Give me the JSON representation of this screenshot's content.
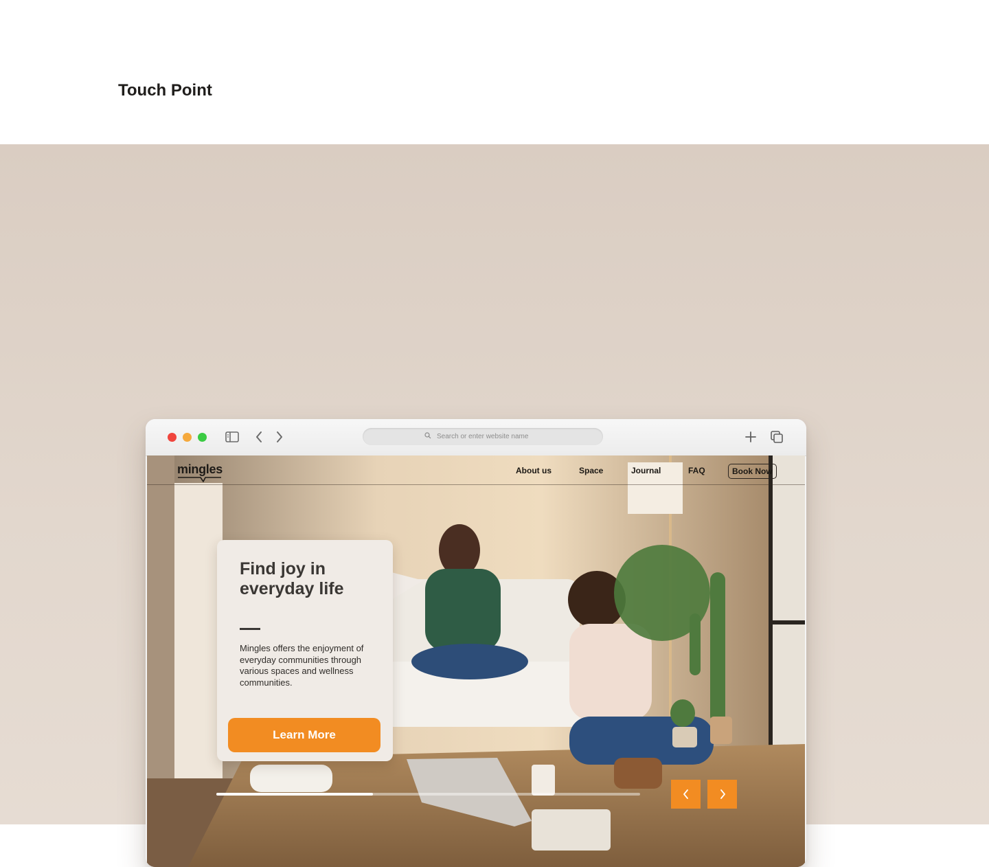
{
  "page": {
    "title": "Touch Point"
  },
  "browser": {
    "search": {
      "placeholder": "Search or enter website name"
    },
    "icons": [
      "sidebar-icon",
      "chevron-left-icon",
      "chevron-right-icon",
      "search-icon",
      "plus-icon",
      "tabs-icon"
    ]
  },
  "site": {
    "logo": "mingles",
    "nav": {
      "items": [
        {
          "label": "About us"
        },
        {
          "label": "Space"
        },
        {
          "label": "Journal"
        },
        {
          "label": "FAQ"
        }
      ],
      "cta": "Book Now"
    },
    "hero": {
      "title": "Find joy in everyday life",
      "body": "Mingles offers the enjoyment of everyday communities through various spaces and wellness communities.",
      "button": "Learn More",
      "progress": 0.37
    }
  },
  "colors": {
    "accent": "#f28c22",
    "card": "#f0ebe6",
    "backdrop": "#dfd3c8",
    "heading": "#3a3734"
  }
}
